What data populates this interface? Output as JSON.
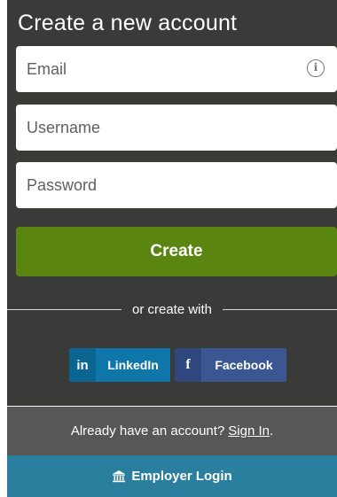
{
  "title": "Create a new account",
  "form": {
    "email_placeholder": "Email",
    "username_placeholder": "Username",
    "password_placeholder": "Password",
    "info_icon": "info-icon",
    "info_glyph": "i",
    "create_label": "Create"
  },
  "divider_text": "or create with",
  "social": {
    "linkedin_icon_text": "in",
    "linkedin_label": "LinkedIn",
    "facebook_icon_text": "f",
    "facebook_label": "Facebook"
  },
  "signin": {
    "prompt": "Already have an account?",
    "link": "Sign In",
    "suffix": "."
  },
  "employer": {
    "icon": "bank-icon",
    "label": "Employer Login"
  },
  "colors": {
    "panel_bg": "#3a3a38",
    "create_button": "#5a8510",
    "linkedin": "#0e76a8",
    "facebook": "#3b5793",
    "signin_bar": "#575757",
    "employer_bar": "#2a7f9e"
  }
}
